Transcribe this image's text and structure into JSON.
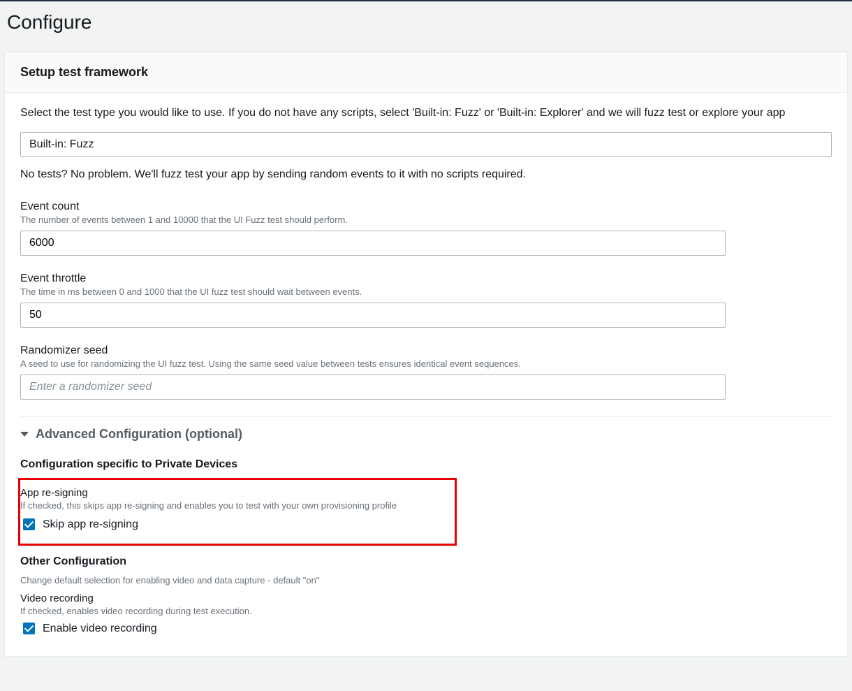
{
  "page": {
    "title": "Configure"
  },
  "panel": {
    "header": "Setup test framework",
    "intro": "Select the test type you would like to use. If you do not have any scripts, select 'Built-in: Fuzz' or 'Built-in: Explorer' and we will fuzz test or explore your app",
    "test_type": {
      "selected": "Built-in: Fuzz"
    },
    "hint": "No tests? No problem. We'll fuzz test your app by sending random events to it with no scripts required."
  },
  "fields": {
    "event_count": {
      "label": "Event count",
      "desc": "The number of events between 1 and 10000 that the UI Fuzz test should perform.",
      "value": "6000"
    },
    "event_throttle": {
      "label": "Event throttle",
      "desc": "The time in ms between 0 and 1000 that the UI fuzz test should wait between events.",
      "value": "50"
    },
    "randomizer": {
      "label": "Randomizer seed",
      "desc": "A seed to use for randomizing the UI fuzz test. Using the same seed value between tests ensures identical event sequences.",
      "placeholder": "Enter a randomizer seed",
      "value": ""
    }
  },
  "advanced": {
    "title": "Advanced Configuration (optional)"
  },
  "private_devices": {
    "heading": "Configuration specific to Private Devices",
    "app_resigning": {
      "label": "App re-signing",
      "desc": "If checked, this skips app re-signing and enables you to test with your own provisioning profile",
      "checkbox_label": "Skip app re-signing",
      "checked": true
    }
  },
  "other_config": {
    "heading": "Other Configuration",
    "desc": "Change default selection for enabling video and data capture - default \"on\"",
    "video": {
      "label": "Video recording",
      "desc": "If checked, enables video recording during test execution.",
      "checkbox_label": "Enable video recording",
      "checked": true
    }
  }
}
